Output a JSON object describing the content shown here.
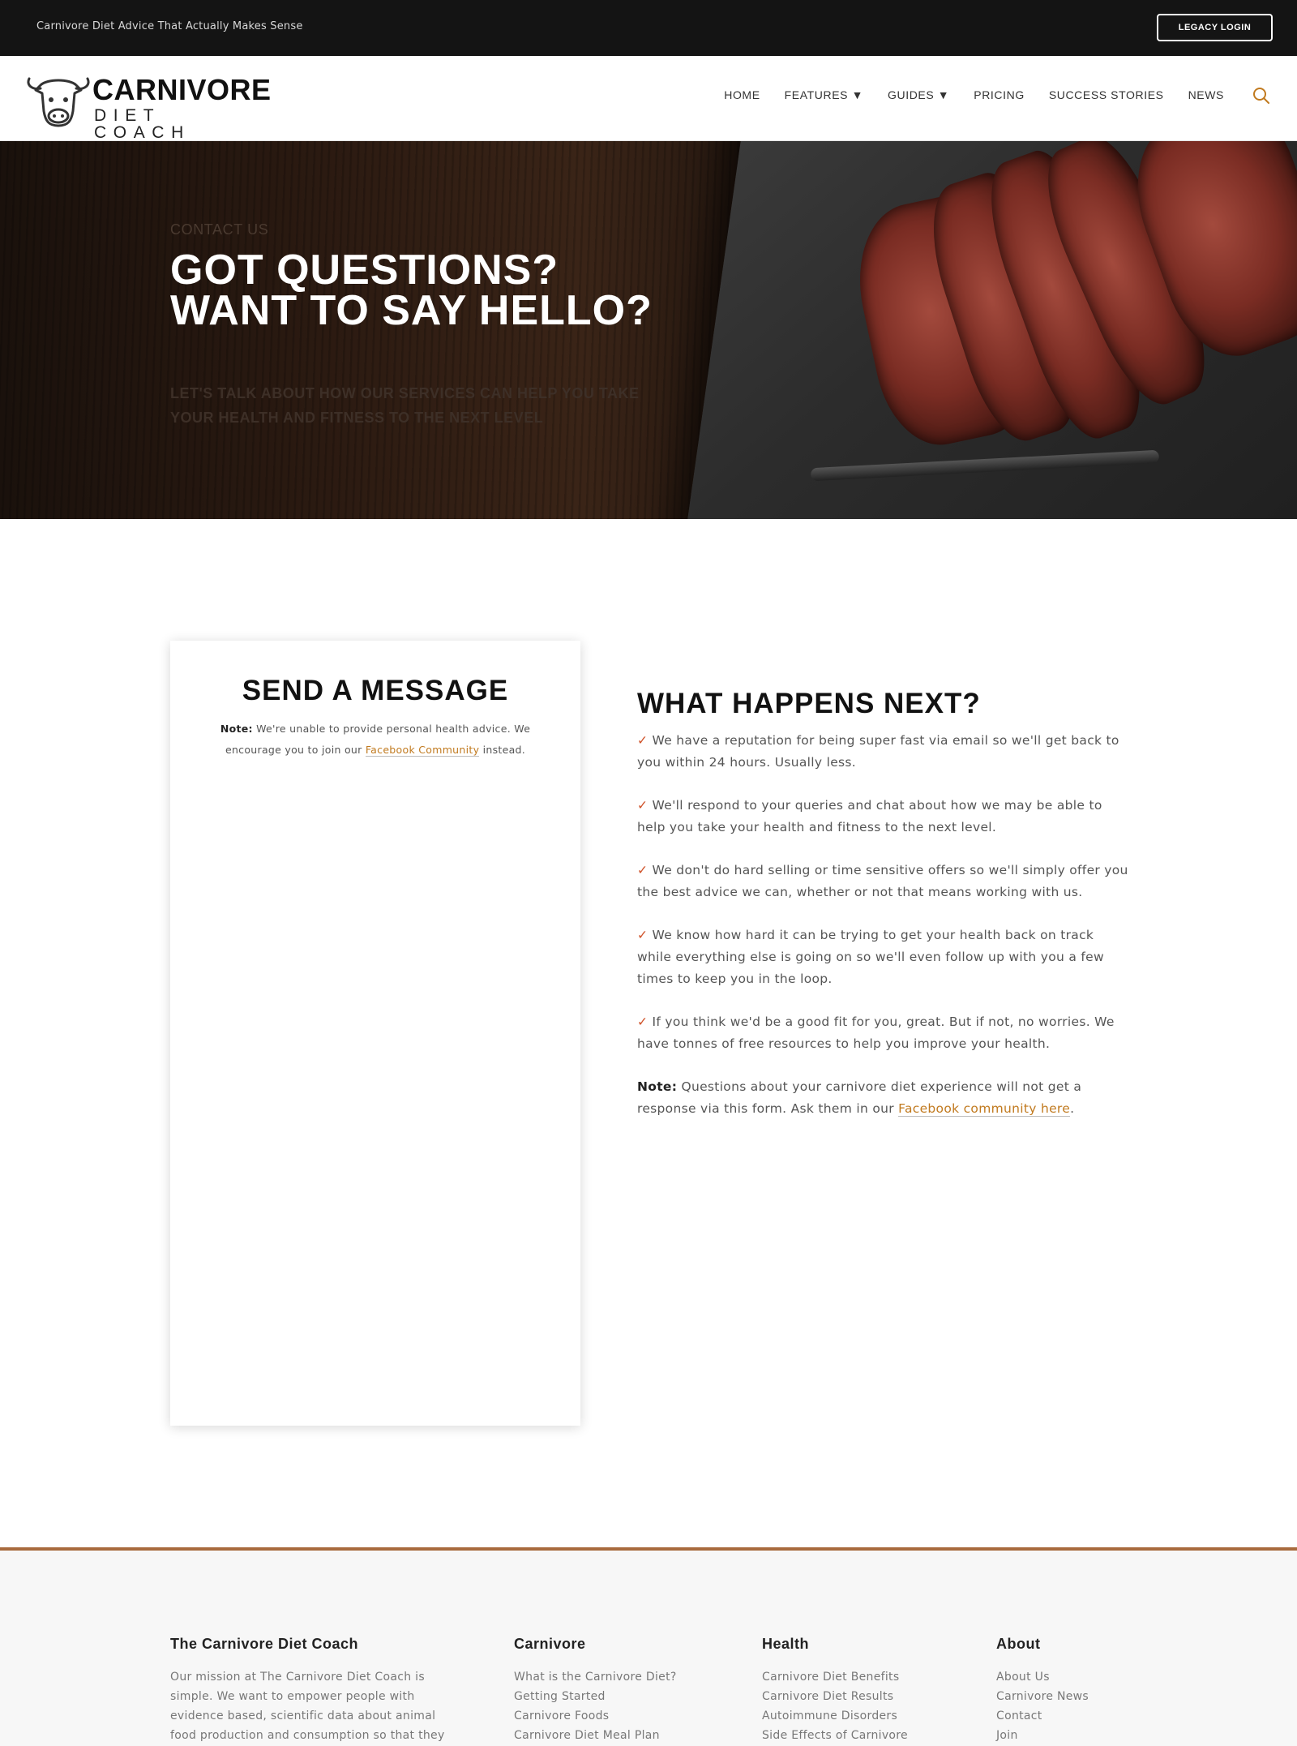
{
  "topbar": {
    "tagline": "Carnivore Diet Advice That Actually Makes Sense",
    "legacy_login": "LEGACY LOGIN"
  },
  "header": {
    "brand_top": "CARNIVORE",
    "brand_bottom": "DIET COACH",
    "nav": [
      {
        "label": "HOME"
      },
      {
        "label": "FEATURES ▼"
      },
      {
        "label": "GUIDES ▼"
      },
      {
        "label": "PRICING"
      },
      {
        "label": "SUCCESS STORIES"
      },
      {
        "label": "NEWS"
      }
    ],
    "search_icon": "search-icon",
    "accent": "#c17a1f"
  },
  "hero": {
    "kicker": "CONTACT US",
    "title": "GOT QUESTIONS? WANT TO SAY HELLO?",
    "subtitle": "LET'S TALK ABOUT HOW OUR SERVICES CAN HELP YOU TAKE YOUR HEALTH AND FITNESS TO THE NEXT LEVEL"
  },
  "message": {
    "title": "SEND A MESSAGE",
    "note_label": "Note:",
    "note_text": " We're unable to provide personal health advice. We encourage you to join our ",
    "note_link": "Facebook Community",
    "note_tail": " instead."
  },
  "next": {
    "title": "WHAT HAPPENS NEXT?",
    "check": "✓",
    "items": [
      {
        "text": " We have a reputation for being super fast via email so we'll get back to you within 24 hours. Usually less."
      },
      {
        "text": " We'll respond to your queries and chat about how we may be able to help you take your health and fitness to the next level."
      },
      {
        "text": " We don't do hard selling or time sensitive offers so we'll simply offer you the best advice we can, whether or not that means working with us."
      },
      {
        "text": " We know how hard it can be trying to get your health back on track while everything else is going on so we'll even follow up with you a few times to keep you in the loop."
      },
      {
        "text": " If you think we'd be a good fit for you, great. But if not, no worries. We have tonnes of free resources to help you improve your health."
      }
    ],
    "note_label": "Note:",
    "note_text": " Questions about your carnivore diet experience will not get a response via this form. Ask them in our ",
    "note_link": "Facebook community here",
    "note_tail": "."
  },
  "footer": {
    "col1": {
      "title": "The Carnivore Diet Coach",
      "mission": "Our mission at The Carnivore Diet Coach is simple. We want to empower people with evidence based, scientific data about animal food production and consumption so that they"
    },
    "col2": {
      "title": "Carnivore",
      "links": [
        {
          "label": "What is the Carnivore Diet?"
        },
        {
          "label": "Getting Started"
        },
        {
          "label": "Carnivore Foods"
        },
        {
          "label": "Carnivore Diet Meal Plan"
        }
      ]
    },
    "col3": {
      "title": "Health",
      "links": [
        {
          "label": "Carnivore Diet Benefits"
        },
        {
          "label": "Carnivore Diet Results"
        },
        {
          "label": "Autoimmune Disorders"
        },
        {
          "label": "Side Effects of Carnivore"
        }
      ]
    },
    "col4": {
      "title": "About",
      "links": [
        {
          "label": "About Us"
        },
        {
          "label": "Carnivore News"
        },
        {
          "label": "Contact"
        },
        {
          "label": "Join"
        }
      ]
    },
    "rule_color": "#a86a3d"
  }
}
